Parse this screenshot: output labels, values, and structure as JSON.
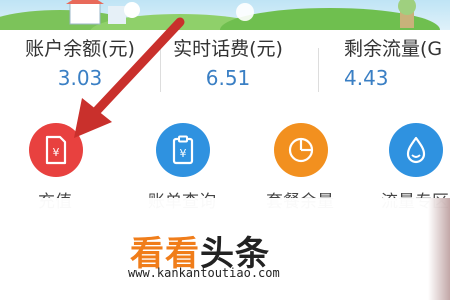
{
  "stats": [
    {
      "label": "账户余额(元)",
      "value": "3.03"
    },
    {
      "label": "实时话费(元)",
      "value": "6.51"
    },
    {
      "label": "剩余流量(G",
      "value": "4.43"
    }
  ],
  "services": [
    {
      "label": "充值",
      "color": "#e8413f",
      "icon": "receipt-yen-icon"
    },
    {
      "label": "账单查询",
      "color": "#2f92e0",
      "icon": "clipboard-yen-icon"
    },
    {
      "label": "套餐余量",
      "color": "#f2901f",
      "icon": "pie-chart-icon"
    },
    {
      "label": "流量专区",
      "color": "#2f92e0",
      "icon": "droplet-icon"
    }
  ],
  "watermark": {
    "title_part1": "看看",
    "title_part2": "头条",
    "url": "www.kankantoutiao.com"
  },
  "colors": {
    "value_text": "#3a7fc4",
    "arrow": "#c9302c"
  }
}
